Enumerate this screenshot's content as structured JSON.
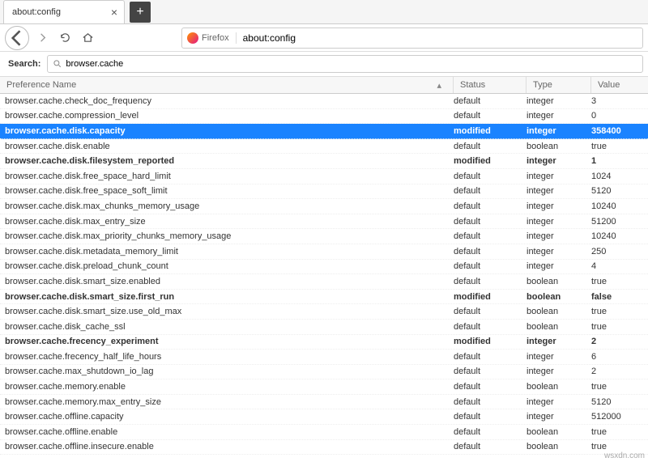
{
  "tab": {
    "title": "about:config"
  },
  "browser": {
    "brand": "Firefox",
    "url": "about:config"
  },
  "search": {
    "label": "Search:",
    "value": "browser.cache"
  },
  "columns": {
    "name": "Preference Name",
    "status": "Status",
    "type": "Type",
    "value": "Value"
  },
  "prefs": [
    {
      "name": "browser.cache.check_doc_frequency",
      "status": "default",
      "type": "integer",
      "value": "3",
      "modified": false,
      "selected": false
    },
    {
      "name": "browser.cache.compression_level",
      "status": "default",
      "type": "integer",
      "value": "0",
      "modified": false,
      "selected": false
    },
    {
      "name": "browser.cache.disk.capacity",
      "status": "modified",
      "type": "integer",
      "value": "358400",
      "modified": true,
      "selected": true
    },
    {
      "name": "browser.cache.disk.enable",
      "status": "default",
      "type": "boolean",
      "value": "true",
      "modified": false,
      "selected": false
    },
    {
      "name": "browser.cache.disk.filesystem_reported",
      "status": "modified",
      "type": "integer",
      "value": "1",
      "modified": true,
      "selected": false
    },
    {
      "name": "browser.cache.disk.free_space_hard_limit",
      "status": "default",
      "type": "integer",
      "value": "1024",
      "modified": false,
      "selected": false
    },
    {
      "name": "browser.cache.disk.free_space_soft_limit",
      "status": "default",
      "type": "integer",
      "value": "5120",
      "modified": false,
      "selected": false
    },
    {
      "name": "browser.cache.disk.max_chunks_memory_usage",
      "status": "default",
      "type": "integer",
      "value": "10240",
      "modified": false,
      "selected": false
    },
    {
      "name": "browser.cache.disk.max_entry_size",
      "status": "default",
      "type": "integer",
      "value": "51200",
      "modified": false,
      "selected": false
    },
    {
      "name": "browser.cache.disk.max_priority_chunks_memory_usage",
      "status": "default",
      "type": "integer",
      "value": "10240",
      "modified": false,
      "selected": false
    },
    {
      "name": "browser.cache.disk.metadata_memory_limit",
      "status": "default",
      "type": "integer",
      "value": "250",
      "modified": false,
      "selected": false
    },
    {
      "name": "browser.cache.disk.preload_chunk_count",
      "status": "default",
      "type": "integer",
      "value": "4",
      "modified": false,
      "selected": false
    },
    {
      "name": "browser.cache.disk.smart_size.enabled",
      "status": "default",
      "type": "boolean",
      "value": "true",
      "modified": false,
      "selected": false
    },
    {
      "name": "browser.cache.disk.smart_size.first_run",
      "status": "modified",
      "type": "boolean",
      "value": "false",
      "modified": true,
      "selected": false
    },
    {
      "name": "browser.cache.disk.smart_size.use_old_max",
      "status": "default",
      "type": "boolean",
      "value": "true",
      "modified": false,
      "selected": false
    },
    {
      "name": "browser.cache.disk_cache_ssl",
      "status": "default",
      "type": "boolean",
      "value": "true",
      "modified": false,
      "selected": false
    },
    {
      "name": "browser.cache.frecency_experiment",
      "status": "modified",
      "type": "integer",
      "value": "2",
      "modified": true,
      "selected": false
    },
    {
      "name": "browser.cache.frecency_half_life_hours",
      "status": "default",
      "type": "integer",
      "value": "6",
      "modified": false,
      "selected": false
    },
    {
      "name": "browser.cache.max_shutdown_io_lag",
      "status": "default",
      "type": "integer",
      "value": "2",
      "modified": false,
      "selected": false
    },
    {
      "name": "browser.cache.memory.enable",
      "status": "default",
      "type": "boolean",
      "value": "true",
      "modified": false,
      "selected": false
    },
    {
      "name": "browser.cache.memory.max_entry_size",
      "status": "default",
      "type": "integer",
      "value": "5120",
      "modified": false,
      "selected": false
    },
    {
      "name": "browser.cache.offline.capacity",
      "status": "default",
      "type": "integer",
      "value": "512000",
      "modified": false,
      "selected": false
    },
    {
      "name": "browser.cache.offline.enable",
      "status": "default",
      "type": "boolean",
      "value": "true",
      "modified": false,
      "selected": false
    },
    {
      "name": "browser.cache.offline.insecure.enable",
      "status": "default",
      "type": "boolean",
      "value": "true",
      "modified": false,
      "selected": false
    }
  ],
  "watermark": "wsxdn.com"
}
